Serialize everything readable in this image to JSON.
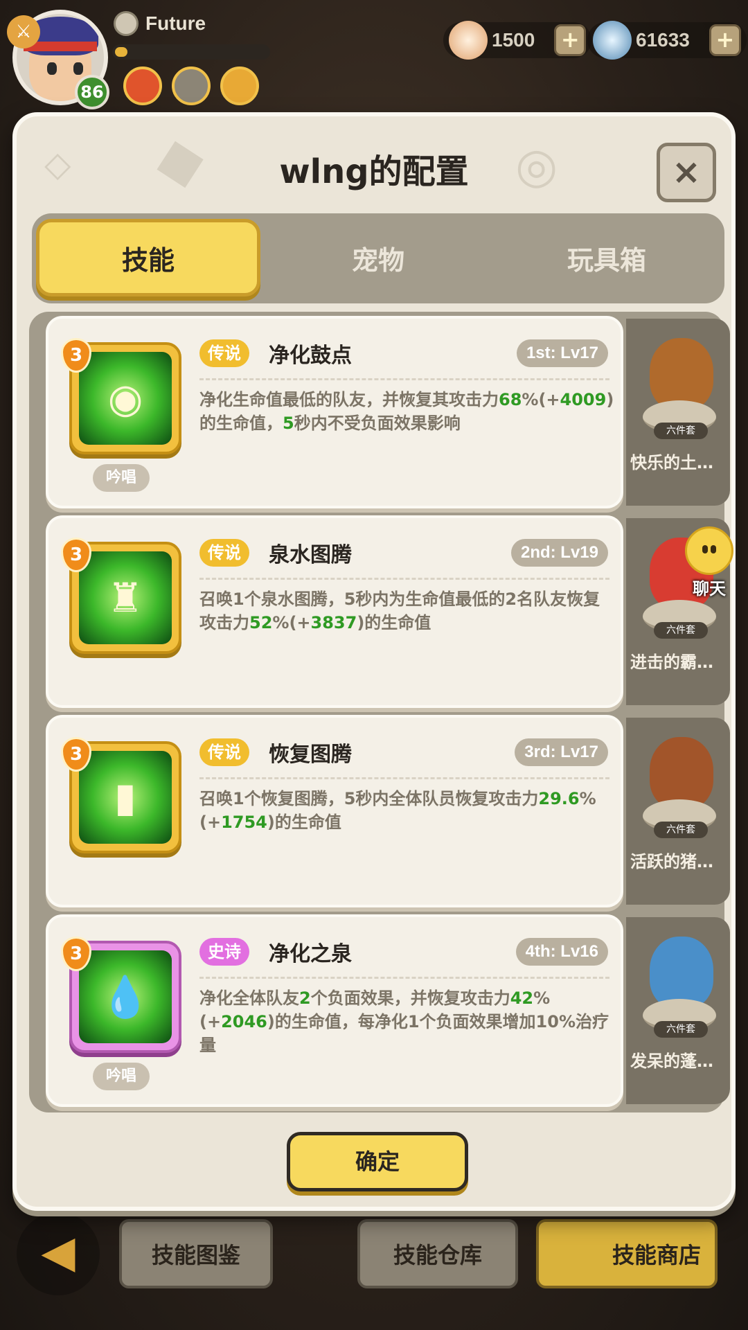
{
  "player": {
    "name": "Future",
    "level": "86",
    "xp_fraction": 0.08
  },
  "currencies": [
    {
      "value": "1500",
      "icon": "shell-starfish-icon"
    },
    {
      "value": "61633",
      "icon": "pearl-clam-icon"
    }
  ],
  "panel": {
    "title": "wlng的配置",
    "close_label": "×"
  },
  "tabs": [
    {
      "label": "技能",
      "active": true
    },
    {
      "label": "宠物",
      "active": false
    },
    {
      "label": "玩具箱",
      "active": false
    }
  ],
  "skills": [
    {
      "level": "3",
      "rarity": "传说",
      "rarity_type": "legend",
      "name": "净化鼓点",
      "slot": "1st: Lv17",
      "desc_parts": [
        [
          "净化生命值最低的队友，并恢复其攻击力",
          false
        ],
        [
          "68",
          true
        ],
        [
          "%(+",
          false
        ],
        [
          "4009",
          true
        ],
        [
          ")的生命值，",
          false
        ],
        [
          "5",
          true
        ],
        [
          "秒内不受负面效果影响",
          false
        ]
      ],
      "tag": "吟唱",
      "icon": "drum-icon"
    },
    {
      "level": "3",
      "rarity": "传说",
      "rarity_type": "legend",
      "name": "泉水图腾",
      "slot": "2nd: Lv19",
      "desc_parts": [
        [
          "召唤1个泉水图腾，5秒内为生命值最低的2名队友恢复攻击力",
          false
        ],
        [
          "52",
          true
        ],
        [
          "%(+",
          false
        ],
        [
          "3837",
          true
        ],
        [
          ")的生命值",
          false
        ]
      ],
      "tag": "",
      "icon": "fountain-totem-icon"
    },
    {
      "level": "3",
      "rarity": "传说",
      "rarity_type": "legend",
      "name": "恢复图腾",
      "slot": "3rd: Lv17",
      "desc_parts": [
        [
          "召唤1个恢复图腾，5秒内全体队员恢复攻击力",
          false
        ],
        [
          "29.6",
          true
        ],
        [
          "%(+",
          false
        ],
        [
          "1754",
          true
        ],
        [
          ")的生命值",
          false
        ]
      ],
      "tag": "",
      "icon": "heal-totem-icon"
    },
    {
      "level": "3",
      "rarity": "史诗",
      "rarity_type": "epic",
      "name": "净化之泉",
      "slot": "4th: Lv16",
      "desc_parts": [
        [
          "净化全体队友",
          false
        ],
        [
          "2",
          true
        ],
        [
          "个负面效果，并恢复攻击力",
          false
        ],
        [
          "42",
          true
        ],
        [
          "%(+",
          false
        ],
        [
          "2046",
          true
        ],
        [
          ")的生命值，每净化1个负面效果增加10%治疗量",
          false
        ]
      ],
      "tag": "吟唱",
      "icon": "purify-drop-icon"
    }
  ],
  "pets": [
    {
      "set": "六件套",
      "name": "快乐的土…",
      "color": "#b06a2c"
    },
    {
      "set": "六件套",
      "name": "进击的霸…",
      "color": "#d83c31"
    },
    {
      "set": "六件套",
      "name": "活跃的猪…",
      "color": "#a2552a"
    },
    {
      "set": "六件套",
      "name": "发呆的蓬…",
      "color": "#4a8fc9"
    }
  ],
  "chat": {
    "label": "聊天"
  },
  "confirm_label": "确定",
  "bottom_buttons": [
    {
      "label": "技能图鉴"
    },
    {
      "label": "技能仓库"
    },
    {
      "label": "技能商店"
    }
  ]
}
